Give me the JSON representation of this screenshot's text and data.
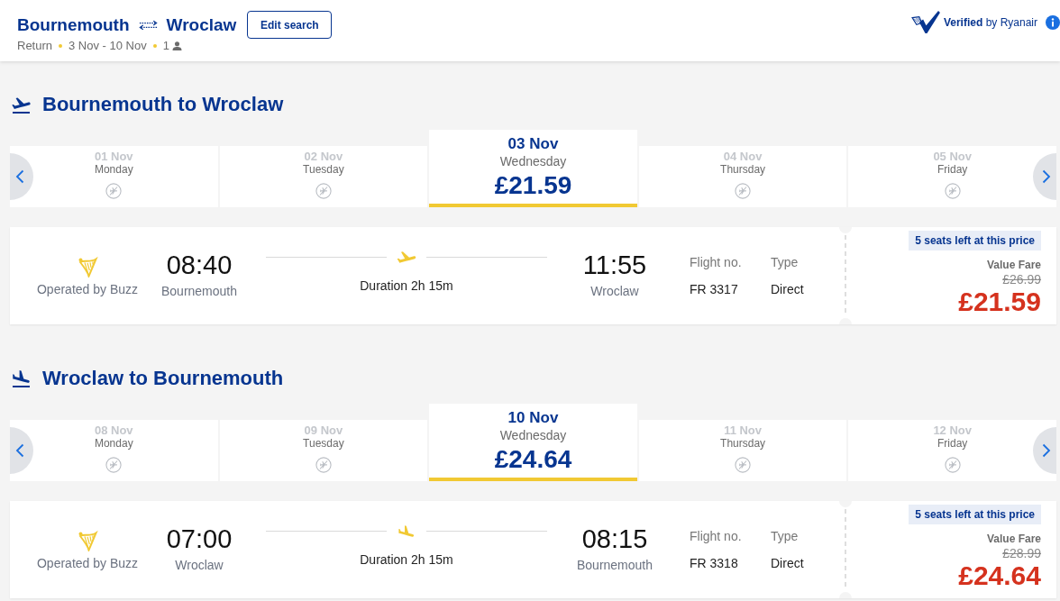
{
  "header": {
    "origin": "Bournemouth",
    "destination": "Wroclaw",
    "edit_button": "Edit search",
    "trip_type": "Return",
    "dates": "3 Nov - 10 Nov",
    "passengers": "1",
    "verified": "**Verified** by Ryanair"
  },
  "journeys": [
    {
      "kind": "outbound",
      "title": "Bournemouth to Wroclaw",
      "days": [
        {
          "date": "01 Nov",
          "weekday": "Monday",
          "available": false,
          "selected": false
        },
        {
          "date": "02 Nov",
          "weekday": "Tuesday",
          "available": false,
          "selected": false
        },
        {
          "date": "03 Nov",
          "weekday": "Wednesday",
          "available": true,
          "price": "£21.59",
          "selected": true
        },
        {
          "date": "04 Nov",
          "weekday": "Thursday",
          "available": false,
          "selected": false
        },
        {
          "date": "05 Nov",
          "weekday": "Friday",
          "available": false,
          "selected": false
        }
      ],
      "flight": {
        "operator": "Operated by Buzz",
        "depart_time": "08:40",
        "depart_airport": "Bournemouth",
        "duration": "Duration 2h 15m",
        "arrive_time": "11:55",
        "arrive_airport": "Wroclaw",
        "flight_no_label": "Flight no.",
        "flight_no": "FR 3317",
        "type_label": "Type",
        "type": "Direct",
        "seats_badge": "5 seats left at this price",
        "fare_name": "Value Fare",
        "old_price": "£26.99",
        "price": "£21.59"
      }
    },
    {
      "kind": "inbound",
      "title": "Wroclaw to Bournemouth",
      "days": [
        {
          "date": "08 Nov",
          "weekday": "Monday",
          "available": false,
          "selected": false
        },
        {
          "date": "09 Nov",
          "weekday": "Tuesday",
          "available": false,
          "selected": false
        },
        {
          "date": "10 Nov",
          "weekday": "Wednesday",
          "available": true,
          "price": "£24.64",
          "selected": true
        },
        {
          "date": "11 Nov",
          "weekday": "Thursday",
          "available": false,
          "selected": false
        },
        {
          "date": "12 Nov",
          "weekday": "Friday",
          "available": false,
          "selected": false
        }
      ],
      "flight": {
        "operator": "Operated by Buzz",
        "depart_time": "07:00",
        "depart_airport": "Wroclaw",
        "duration": "Duration 2h 15m",
        "arrive_time": "08:15",
        "arrive_airport": "Bournemouth",
        "flight_no_label": "Flight no.",
        "flight_no": "FR 3318",
        "type_label": "Type",
        "type": "Direct",
        "seats_badge": "5 seats left at this price",
        "fare_name": "Value Fare",
        "old_price": "£28.99",
        "price": "£24.64"
      }
    }
  ]
}
